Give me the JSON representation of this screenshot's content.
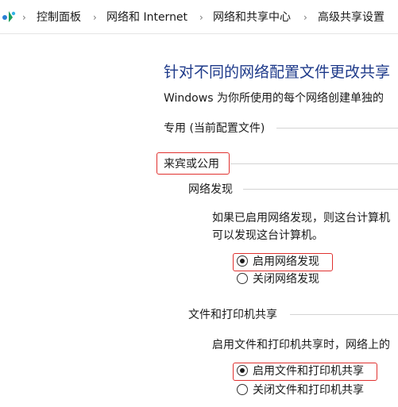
{
  "breadcrumb": {
    "icon": "control-panel-icon",
    "separator": "›",
    "items": [
      "控制面板",
      "网络和 Internet",
      "网络和共享中心",
      "高级共享设置"
    ]
  },
  "title": "针对不同的网络配置文件更改共享",
  "description": "Windows 为你所使用的每个网络创建单独的",
  "profiles": {
    "private_label": "专用 (当前配置文件)",
    "guest_public_label": "来宾或公用"
  },
  "network_discovery": {
    "heading": "网络发现",
    "text_line1": "如果已启用网络发现，则这台计算机",
    "text_line2": "可以发现这台计算机。",
    "option_on": "启用网络发现",
    "option_off": "关闭网络发现",
    "selected": "on"
  },
  "file_printer_sharing": {
    "heading": "文件和打印机共享",
    "text_line1": "启用文件和打印机共享时，网络上的",
    "option_on": "启用文件和打印机共享",
    "option_off": "关闭文件和打印机共享",
    "selected": "on"
  },
  "colors": {
    "title": "#1e3a8a",
    "highlight_box": "#e0312f"
  }
}
